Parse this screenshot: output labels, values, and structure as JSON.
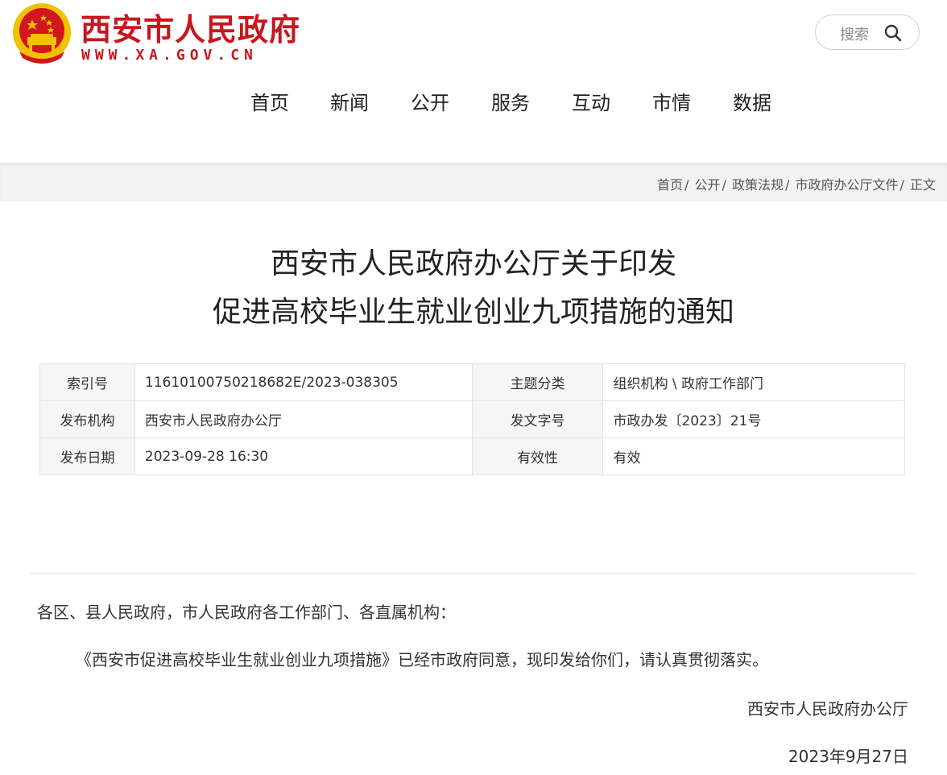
{
  "header": {
    "site_name": "西安市人民政府",
    "site_url": "WWW.XA.GOV.CN",
    "emblem_icon": "national-emblem-icon",
    "search": {
      "label": "搜索",
      "icon": "search-icon"
    },
    "nav": [
      "首页",
      "新闻",
      "公开",
      "服务",
      "互动",
      "市情",
      "数据"
    ]
  },
  "breadcrumb": [
    "首页",
    "公开",
    "政策法规",
    "市政府办公厅文件",
    "正文"
  ],
  "article": {
    "title_line1": "西安市人民政府办公厅关于印发",
    "title_line2": "促进高校毕业生就业创业九项措施的通知",
    "meta": {
      "index_label": "索引号",
      "index_value": "11610100750218682E/2023-038305",
      "topic_label": "主题分类",
      "topic_value": "组织机构 \\ 政府工作部门",
      "publisher_label": "发布机构",
      "publisher_value": "西安市人民政府办公厅",
      "doc_no_label": "发文字号",
      "doc_no_value": "市政办发〔2023〕21号",
      "date_label": "发布日期",
      "date_value": "2023-09-28 16:30",
      "validity_label": "有效性",
      "validity_value": "有效"
    },
    "salutation": "各区、县人民政府，市人民政府各工作部门、各直属机构：",
    "body": "《西安市促进高校毕业生就业创业九项措施》已经市政府同意，现印发给你们，请认真贯彻落实。",
    "signer": "西安市人民政府办公厅",
    "sign_date": "2023年9月27日"
  },
  "colors": {
    "brand_red": "#c8161d",
    "emblem_gold": "#f2c200",
    "bar_gray": "#f2f2f2"
  }
}
